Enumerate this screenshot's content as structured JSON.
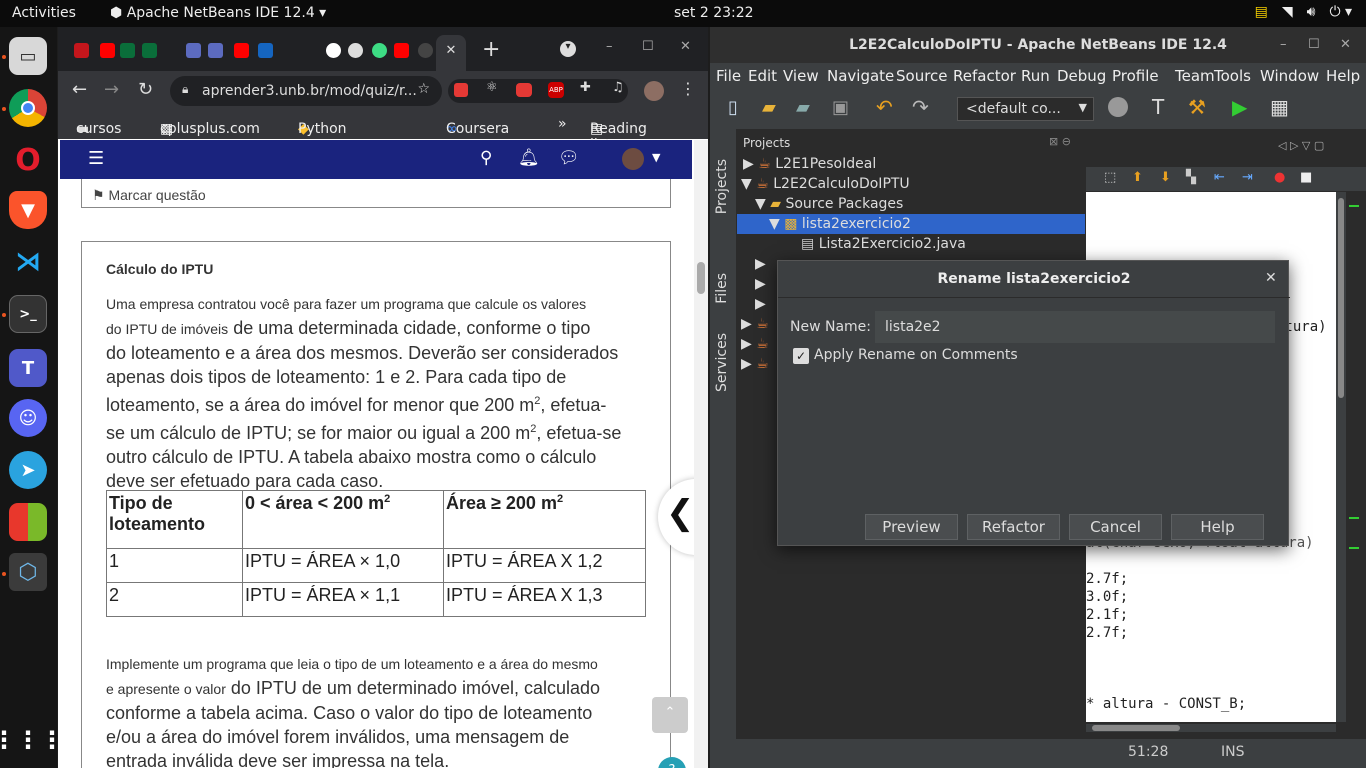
{
  "topbar": {
    "activities": "Activities",
    "app": "Apache NetBeans IDE 12.4",
    "clock": "set 2  23:22"
  },
  "browser": {
    "url": "aprender3.unb.br/mod/quiz/r...",
    "bookmarks": [
      "cursos",
      "cplusplus.com",
      "Python - Docu...",
      "Coursera",
      "»",
      "Reading list"
    ],
    "flag_question": "Marcar questão",
    "question_title": "Cálculo do IPTU",
    "p1_small": "Uma empresa contratou você para fazer um programa que calcule os valores",
    "p1_small2": "do IPTU de imóveis",
    "p1_big_a": "de uma determinada cidade, conforme o tipo",
    "p1_big_b": "do loteamento e a área dos mesmos. Deverão ser considerados",
    "p1_big_c": "apenas dois tipos de loteamento: 1 e 2. Para cada tipo de",
    "p1_big_d1": "loteamento, se a área do imóvel for menor que 200 m",
    "p1_big_d2": ", efetua-",
    "p1_big_e1": "se um cálculo de IPTU; se for maior ou igual a 200 m",
    "p1_big_e2": ", efetua-se",
    "p1_big_f": "outro cálculo de IPTU. A tabela abaixo mostra como o cálculo",
    "p1_big_g": "deve ser efetuado para cada caso.",
    "sup": "2",
    "table": {
      "h1": "Tipo de loteamento",
      "h2": "0 < área < 200 m",
      "h3": "Área ≥ 200 m",
      "rows": [
        [
          "1",
          "IPTU = ÁREA × 1,0",
          "IPTU = ÁREA X 1,2"
        ],
        [
          "2",
          "IPTU = ÁREA × 1,1",
          "IPTU = ÁREA X 1,3"
        ]
      ]
    },
    "p2_small": "Implemente um programa que leia o tipo de um loteamento e a área do mesmo",
    "p2_small2": "e apresente o valor",
    "p2_big_a": "do IPTU de um determinado imóvel, calculado",
    "p2_big_b": "conforme a tabela acima. Caso o valor do tipo de loteamento",
    "p2_big_c": "e/ou a área do imóvel forem inválidos, uma mensagem de",
    "p2_big_d": "entrada inválida deve ser impressa na tela.",
    "help": "?"
  },
  "netbeans": {
    "title": "L2E2CalculoDoIPTU - Apache NetBeans IDE 12.4",
    "menu": [
      "File",
      "Edit",
      "View",
      "Navigate",
      "Source",
      "Refactor",
      "Run",
      "Debug",
      "Profile",
      "Team",
      "Tools",
      "Window",
      "Help"
    ],
    "config": "<default co...",
    "sidetabs": [
      "Projects",
      "Files",
      "Services"
    ],
    "projects_label": "Projects",
    "tree": [
      "L2E1PesoIdeal",
      "L2E2CalculoDoIPTU",
      "Source Packages",
      "lista2exercicio2",
      "Lista2Exercicio2.java"
    ],
    "code": [
      "ltura)",
      "at(char sexo, float altura)",
      "2.7f;",
      "3.0f;",
      "2.1f;",
      "2.7f;",
      "* altura - CONST_B;"
    ],
    "status_pos": "51:28",
    "status_mode": "INS"
  },
  "dialog": {
    "title": "Rename  lista2exercicio2",
    "new_name_label": "New Name:",
    "new_name_value": "lista2e2",
    "apply_label": "Apply Rename on Comments",
    "buttons": [
      "Preview",
      "Refactor",
      "Cancel",
      "Help"
    ]
  }
}
